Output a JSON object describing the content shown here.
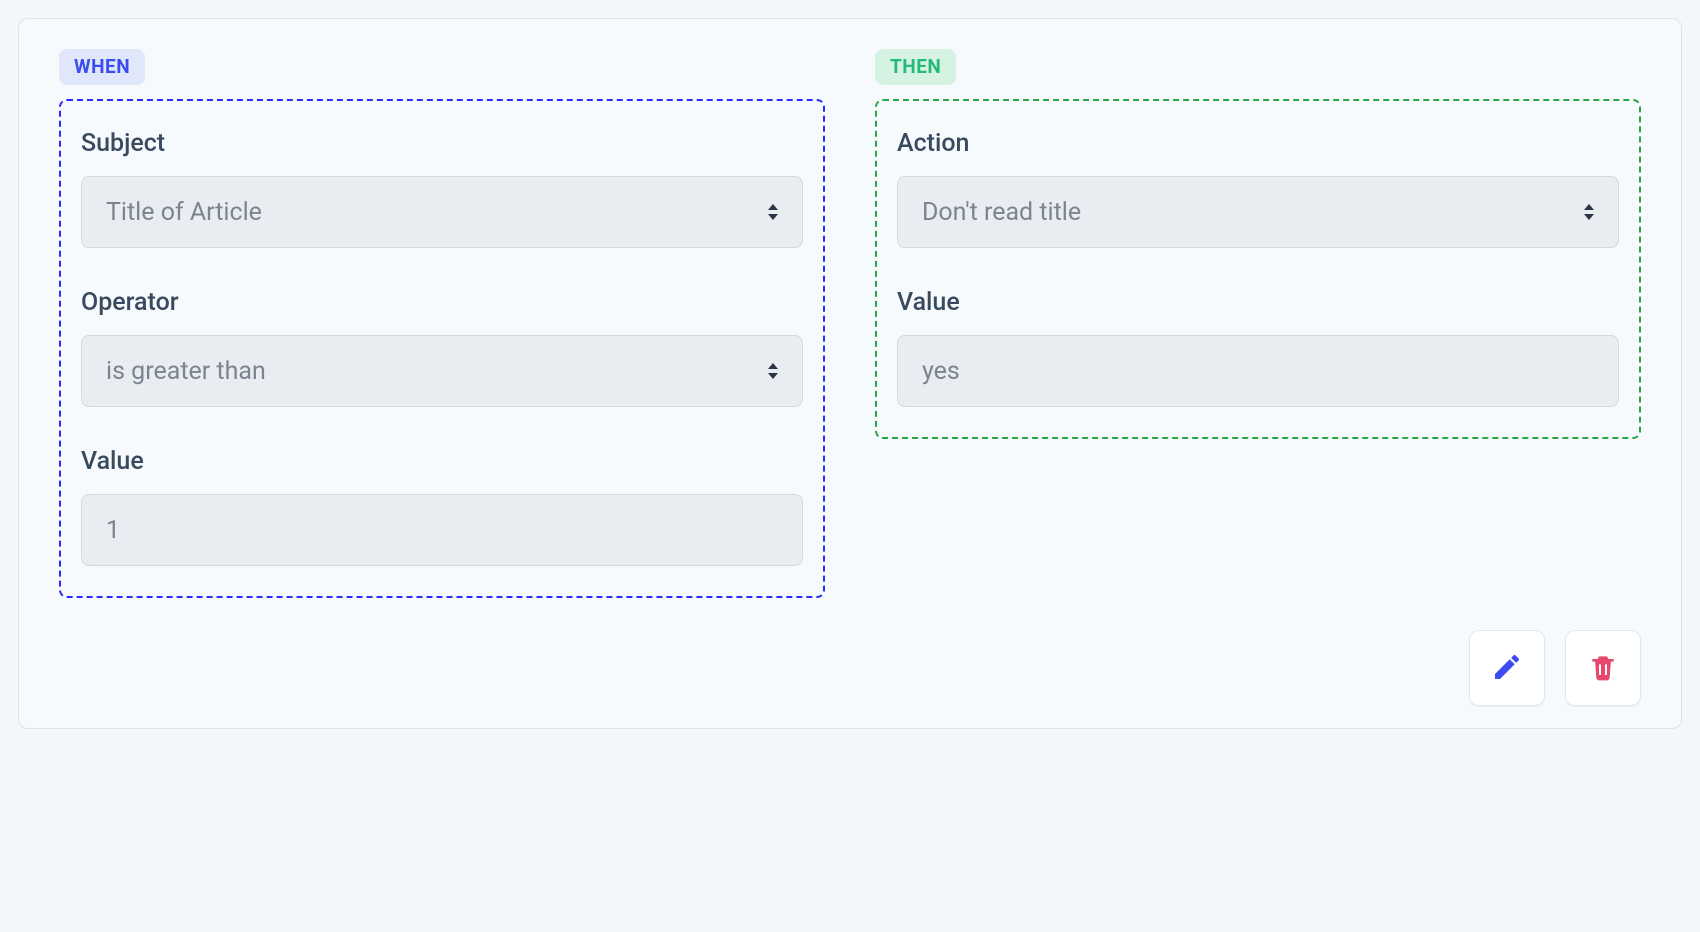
{
  "when": {
    "badge": "WHEN",
    "subject": {
      "label": "Subject",
      "value": "Title of Article"
    },
    "operator": {
      "label": "Operator",
      "value": "is greater than"
    },
    "value": {
      "label": "Value",
      "value": "1"
    }
  },
  "then": {
    "badge": "THEN",
    "action": {
      "label": "Action",
      "value": "Don't read title"
    },
    "value": {
      "label": "Value",
      "value": "yes"
    }
  },
  "icons": {
    "edit": "pencil-icon",
    "delete": "trash-icon"
  },
  "colors": {
    "when_border": "#2b2bff",
    "then_border": "#2aa745",
    "edit_icon": "#3b4df0",
    "delete_icon": "#e7486b"
  }
}
